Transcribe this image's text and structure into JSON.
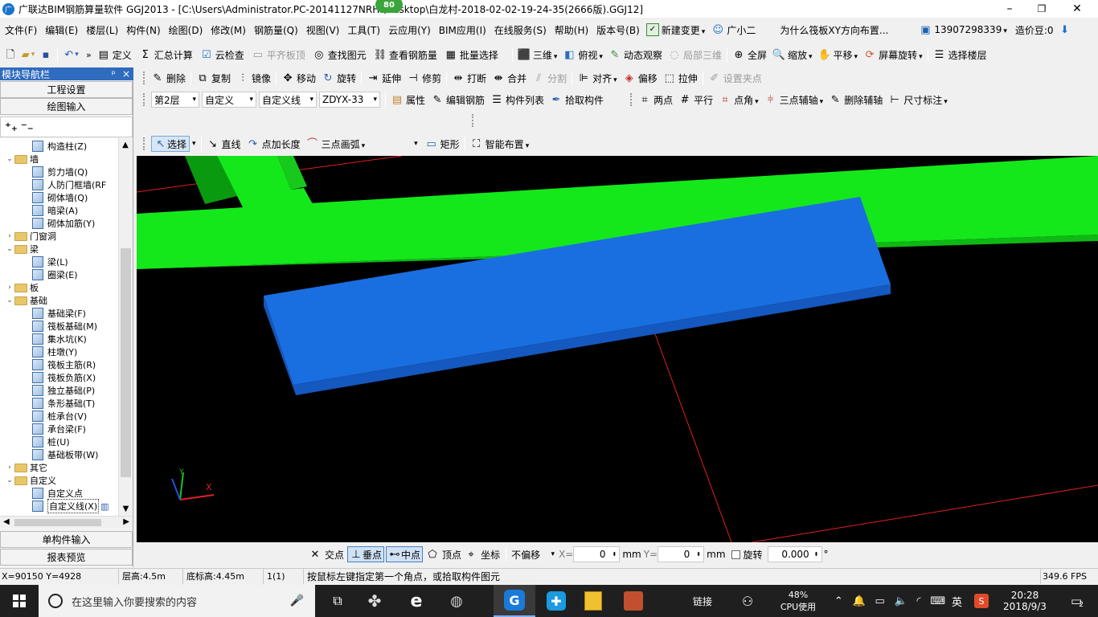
{
  "window": {
    "logo": "广",
    "title": "广联达BIM钢筋算量软件 GGJ2013 - [C:\\Users\\Administrator.PC-20141127NRHI\\Desktop\\白龙村-2018-02-02-19-24-35(2666版).GGJ12]",
    "badge": "80",
    "min": "–",
    "max": "❐",
    "close": "✕"
  },
  "menu": {
    "items": [
      "文件(F)",
      "编辑(E)",
      "楼层(L)",
      "构件(N)",
      "绘图(D)",
      "修改(M)",
      "钢筋量(Q)",
      "视图(V)",
      "工具(T)",
      "云应用(Y)",
      "BIM应用(I)",
      "在线服务(S)",
      "帮助(H)",
      "版本号(B)"
    ],
    "new_change": "新建变更",
    "assistant": "广小二",
    "ad": "为什么筏板XY方向布置...",
    "phone": "13907298339",
    "coins": "造价豆:0"
  },
  "toolbar1": {
    "define": "定义",
    "sum": "汇总计算",
    "cloud_check": "云检查",
    "align_top": "平齐板顶",
    "find": "查找图元",
    "view_rebar": "查看钢筋量",
    "batch_select": "批量选择",
    "view3d": "三维",
    "plan": "俯视",
    "dynamic": "动态观察",
    "local3d": "局部三维",
    "fullscreen": "全屏",
    "zoom": "缩放",
    "pan": "平移",
    "rotate_screen": "屏幕旋转",
    "select_floor": "选择楼层"
  },
  "toolbar2": {
    "delete": "删除",
    "copy": "复制",
    "mirror": "镜像",
    "move": "移动",
    "rotate": "旋转",
    "extend": "延伸",
    "trim": "修剪",
    "break": "打断",
    "merge": "合并",
    "split": "分割",
    "align": "对齐",
    "offset": "偏移",
    "stretch": "拉伸",
    "grip": "设置夹点"
  },
  "toolbar3": {
    "floor": "第2层",
    "category": "自定义",
    "type": "自定义线",
    "name": "ZDYX-33",
    "props": "属性",
    "edit_rebar": "编辑钢筋",
    "comp_list": "构件列表",
    "pick": "拾取构件",
    "two_point": "两点",
    "parallel": "平行",
    "point_angle": "点角",
    "three_point_aux": "三点辅轴",
    "delete_aux": "删除辅轴",
    "dim": "尺寸标注"
  },
  "toolbar4": {
    "select": "选择",
    "line": "直线",
    "point_length": "点加长度",
    "arc": "三点画弧",
    "rect": "矩形",
    "smart": "智能布置"
  },
  "nav": {
    "title": "模块导航栏",
    "pin": "ᵖ",
    "close": "×",
    "project_settings": "工程设置",
    "drawing_input": "绘图输入",
    "single_input": "单构件输入",
    "report": "报表预览"
  },
  "tree": [
    {
      "label": "构造柱(Z)",
      "lv": 2
    },
    {
      "label": "墙",
      "lv": 1,
      "open": true
    },
    {
      "label": "剪力墙(Q)",
      "lv": 2
    },
    {
      "label": "人防门框墙(RF",
      "lv": 2
    },
    {
      "label": "砌体墙(Q)",
      "lv": 2
    },
    {
      "label": "暗梁(A)",
      "lv": 2
    },
    {
      "label": "砌体加筋(Y)",
      "lv": 2
    },
    {
      "label": "门窗洞",
      "lv": 1,
      "open": false
    },
    {
      "label": "梁",
      "lv": 1,
      "open": true
    },
    {
      "label": "梁(L)",
      "lv": 2
    },
    {
      "label": "圈梁(E)",
      "lv": 2
    },
    {
      "label": "板",
      "lv": 1,
      "open": false
    },
    {
      "label": "基础",
      "lv": 1,
      "open": true
    },
    {
      "label": "基础梁(F)",
      "lv": 2
    },
    {
      "label": "筏板基础(M)",
      "lv": 2
    },
    {
      "label": "集水坑(K)",
      "lv": 2
    },
    {
      "label": "柱墩(Y)",
      "lv": 2
    },
    {
      "label": "筏板主筋(R)",
      "lv": 2
    },
    {
      "label": "筏板负筋(X)",
      "lv": 2
    },
    {
      "label": "独立基础(P)",
      "lv": 2
    },
    {
      "label": "条形基础(T)",
      "lv": 2
    },
    {
      "label": "桩承台(V)",
      "lv": 2
    },
    {
      "label": "承台梁(F)",
      "lv": 2
    },
    {
      "label": "桩(U)",
      "lv": 2
    },
    {
      "label": "基础板带(W)",
      "lv": 2
    },
    {
      "label": "其它",
      "lv": 1,
      "open": false
    },
    {
      "label": "自定义",
      "lv": 1,
      "open": true
    },
    {
      "label": "自定义点",
      "lv": 2
    },
    {
      "label": "自定义线(X)",
      "lv": 2,
      "selected": true
    }
  ],
  "snap": {
    "intersect": "交点",
    "perp": "垂点",
    "mid": "中点",
    "vertex": "顶点",
    "coord": "坐标",
    "offset_mode": "不偏移",
    "x_label": "X=",
    "x_value": "0",
    "y_label": "Y=",
    "y_value": "0",
    "unit": "mm",
    "rotate_label": "旋转",
    "rotate_value": "0.000",
    "deg": "°"
  },
  "status": {
    "coords": "X=90150 Y=4928",
    "floor_height": "层高:4.5m",
    "bottom_height": "底标高:4.45m",
    "count": "1(1)",
    "hint": "按鼠标左键指定第一个角点，或拾取构件图元",
    "fps": "349.6 FPS"
  },
  "taskbar": {
    "search": "在这里输入你要搜索的内容",
    "link": "链接",
    "cpu_pct": "48%",
    "cpu": "CPU使用",
    "ime": "英",
    "time": "20:28",
    "date": "2018/9/3",
    "notif": "2"
  },
  "axes": {
    "x": "X",
    "y": "Y"
  },
  "colors": {
    "green": "#14e81a",
    "blue": "#1a6fe0",
    "canvas": "#000000"
  }
}
